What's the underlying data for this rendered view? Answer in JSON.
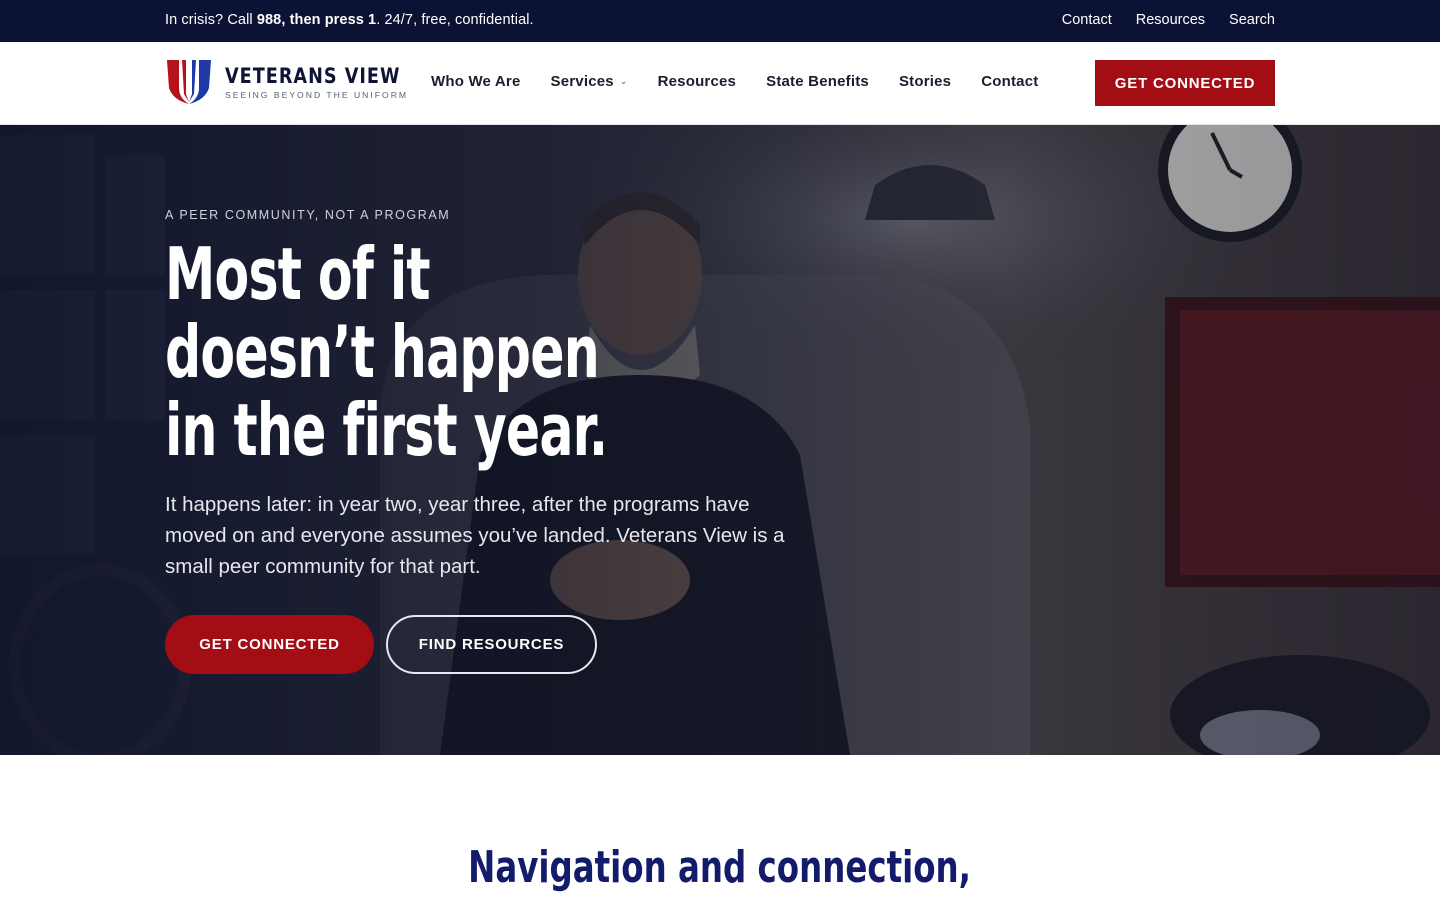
{
  "topbar": {
    "crisis_prefix": "In crisis? Call ",
    "crisis_bold": "988, then press 1",
    "crisis_suffix": ". 24/7, free, confidential.",
    "links": [
      "Contact",
      "Resources",
      "Search"
    ]
  },
  "brand": {
    "name": "VETERANS VIEW",
    "tagline": "SEEING BEYOND THE UNIFORM",
    "colors": {
      "red": "#a30d14",
      "navy": "#0b1233",
      "blue": "#1f3aa8"
    }
  },
  "nav": {
    "items": [
      "Who We Are",
      "Services",
      "Resources",
      "State Benefits",
      "Stories",
      "Contact"
    ],
    "services_has_dropdown": true,
    "cta": "GET CONNECTED"
  },
  "hero": {
    "eyebrow": "A PEER COMMUNITY, NOT A PROGRAM",
    "title_lines": [
      "Most of it",
      "doesn’t happen",
      "in the first year."
    ],
    "subtitle": "It happens later: in year two, year three, after the programs have moved on and everyone assumes you’ve landed. Veterans View is a small peer community for that part.",
    "primary_cta": "GET CONNECTED",
    "secondary_cta": "FIND RESOURCES"
  },
  "section": {
    "title": "Navigation and connection,"
  }
}
